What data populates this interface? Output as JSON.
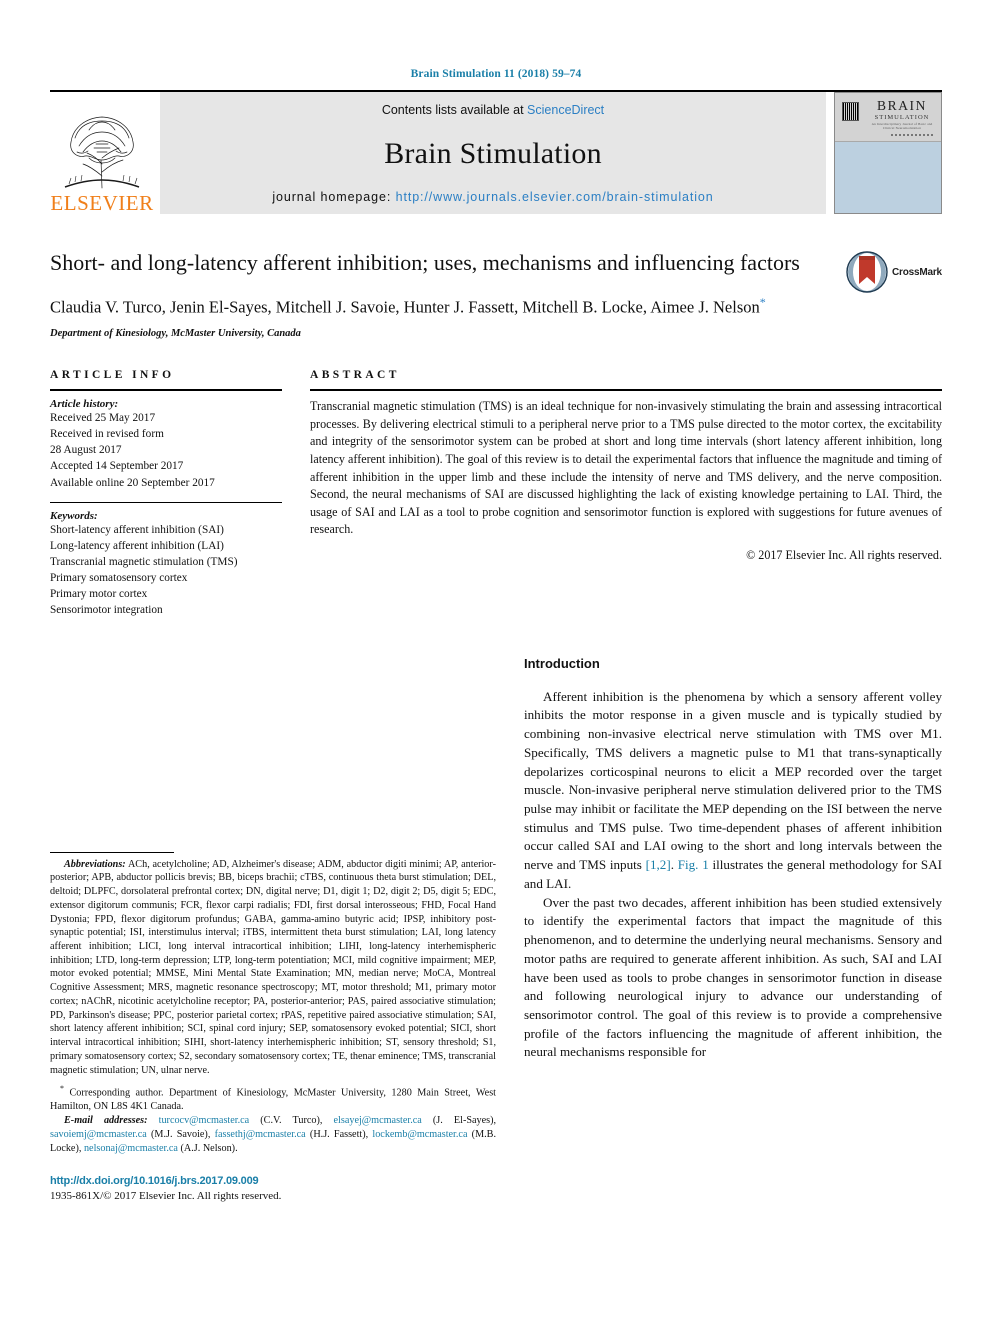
{
  "running_head": "Brain Stimulation 11 (2018) 59–74",
  "banner": {
    "publisher": "ELSEVIER",
    "contents_prefix": "Contents lists available at ",
    "contents_link": "ScienceDirect",
    "journal_title": "Brain Stimulation",
    "homepage_prefix": "journal homepage: ",
    "homepage_url": "http://www.journals.elsevier.com/brain-stimulation",
    "cover": {
      "line1": "BRAIN",
      "line2": "STIMULATION",
      "line3": "An Interdisciplinary Journal of Basic and Clinical Neuromodulation"
    }
  },
  "article": {
    "title": "Short- and long-latency afferent inhibition; uses, mechanisms and influencing factors",
    "crossmark_label": "CrossMark",
    "authors": "Claudia V. Turco, Jenin El-Sayes, Mitchell J. Savoie, Hunter J. Fassett, Mitchell B. Locke, Aimee J. Nelson",
    "corresponding_marker": "*",
    "affiliation": "Department of Kinesiology, McMaster University, Canada"
  },
  "article_info": {
    "heading": "ARTICLE INFO",
    "history_label": "Article history:",
    "history": [
      "Received 25 May 2017",
      "Received in revised form",
      "28 August 2017",
      "Accepted 14 September 2017",
      "Available online 20 September 2017"
    ],
    "keywords_label": "Keywords:",
    "keywords": [
      "Short-latency afferent inhibition (SAI)",
      "Long-latency afferent inhibition (LAI)",
      "Transcranial magnetic stimulation (TMS)",
      "Primary somatosensory cortex",
      "Primary motor cortex",
      "Sensorimotor integration"
    ]
  },
  "abstract": {
    "heading": "ABSTRACT",
    "text": "Transcranial magnetic stimulation (TMS) is an ideal technique for non-invasively stimulating the brain and assessing intracortical processes. By delivering electrical stimuli to a peripheral nerve prior to a TMS pulse directed to the motor cortex, the excitability and integrity of the sensorimotor system can be probed at short and long time intervals (short latency afferent inhibition, long latency afferent inhibition). The goal of this review is to detail the experimental factors that influence the magnitude and timing of afferent inhibition in the upper limb and these include the intensity of nerve and TMS delivery, and the nerve composition. Second, the neural mechanisms of SAI are discussed highlighting the lack of existing knowledge pertaining to LAI. Third, the usage of SAI and LAI as a tool to probe cognition and sensorimotor function is explored with suggestions for future avenues of research.",
    "copyright": "© 2017 Elsevier Inc. All rights reserved."
  },
  "footnotes": {
    "abbreviations_label": "Abbreviations:",
    "abbreviations_text": " ACh, acetylcholine; AD, Alzheimer's disease; ADM, abductor digiti minimi; AP, anterior-posterior; APB, abductor pollicis brevis; BB, biceps brachii; cTBS, continuous theta burst stimulation; DEL, deltoid; DLPFC, dorsolateral prefrontal cortex; DN, digital nerve; D1, digit 1; D2, digit 2; D5, digit 5; EDC, extensor digitorum communis; FCR, flexor carpi radialis; FDI, first dorsal interosseous; FHD, Focal Hand Dystonia; FPD, flexor digitorum profundus; GABA, gamma-amino butyric acid; IPSP, inhibitory post-synaptic potential; ISI, interstimulus interval; iTBS, intermittent theta burst stimulation; LAI, long latency afferent inhibition; LICI, long interval intracortical inhibition; LIHI, long-latency interhemispheric inhibition; LTD, long-term depression; LTP, long-term potentiation; MCI, mild cognitive impairment; MEP, motor evoked potential; MMSE, Mini Mental State Examination; MN, median nerve; MoCA, Montreal Cognitive Assessment; MRS, magnetic resonance spectroscopy; MT, motor threshold; M1, primary motor cortex; nAChR, nicotinic acetylcholine receptor; PA, posterior-anterior; PAS, paired associative stimulation; PD, Parkinson's disease; PPC, posterior parietal cortex; rPAS, repetitive paired associative stimulation; SAI, short latency afferent inhibition; SCI, spinal cord injury; SEP, somatosensory evoked potential; SICI, short interval intracortical inhibition; SIHI, short-latency interhemispheric inhibition; ST, sensory threshold; S1, primary somatosensory cortex; S2, secondary somatosensory cortex; TE, thenar eminence; TMS, transcranial magnetic stimulation; UN, ulnar nerve.",
    "corresponding_marker": "*",
    "corresponding_text": " Corresponding author. Department of Kinesiology, McMaster University, 1280 Main Street, West Hamilton, ON L8S 4K1 Canada.",
    "email_label": "E-mail addresses:",
    "emails": [
      {
        "address": "turcocv@mcmaster.ca",
        "person": "(C.V. Turco)"
      },
      {
        "address": "elsayej@mcmaster.ca",
        "person": "(J. El-Sayes)"
      },
      {
        "address": "savoiemj@mcmaster.ca",
        "person": "(M.J. Savoie)"
      },
      {
        "address": "fassethj@mcmaster.ca",
        "person": "(H.J. Fassett)"
      },
      {
        "address": "lockemb@mcmaster.ca",
        "person": "(M.B. Locke)"
      },
      {
        "address": "nelsonaj@mcmaster.ca",
        "person": "(A.J. Nelson)"
      }
    ],
    "doi": "http://dx.doi.org/10.1016/j.brs.2017.09.009",
    "issn_line": "1935-861X/© 2017 Elsevier Inc. All rights reserved."
  },
  "introduction": {
    "heading": "Introduction",
    "para1_a": "Afferent inhibition is the phenomena by which a sensory afferent volley inhibits the motor response in a given muscle and is typically studied by combining non-invasive electrical nerve stimulation with TMS over M1. Specifically, TMS delivers a magnetic pulse to M1 that trans-synaptically depolarizes corticospinal neurons to elicit a MEP recorded over the target muscle. Non-invasive peripheral nerve stimulation delivered prior to the TMS pulse may inhibit or facilitate the MEP depending on the ISI between the nerve stimulus and TMS pulse. Two time-dependent phases of afferent inhibition occur called SAI and LAI owing to the short and long intervals between the nerve and TMS inputs ",
    "para1_ref1": "[1,2]",
    "para1_b": ". ",
    "para1_ref2": "Fig. 1",
    "para1_c": " illustrates the general methodology for SAI and LAI.",
    "para2": "Over the past two decades, afferent inhibition has been studied extensively to identify the experimental factors that impact the magnitude of this phenomenon, and to determine the underlying neural mechanisms. Sensory and motor paths are required to generate afferent inhibition. As such, SAI and LAI have been used as tools to probe changes in sensorimotor function in disease and following neurological injury to advance our understanding of sensorimotor control. The goal of this review is to provide a comprehensive profile of the factors influencing the magnitude of afferent inhibition, the neural mechanisms responsible for"
  },
  "colors": {
    "link_blue": "#1a7fa8",
    "sciencedirect_blue": "#2b7fc4",
    "elsevier_orange": "#f07f1a",
    "banner_grey": "#e6e6e6",
    "cover_blue": "#bcd0e0"
  }
}
